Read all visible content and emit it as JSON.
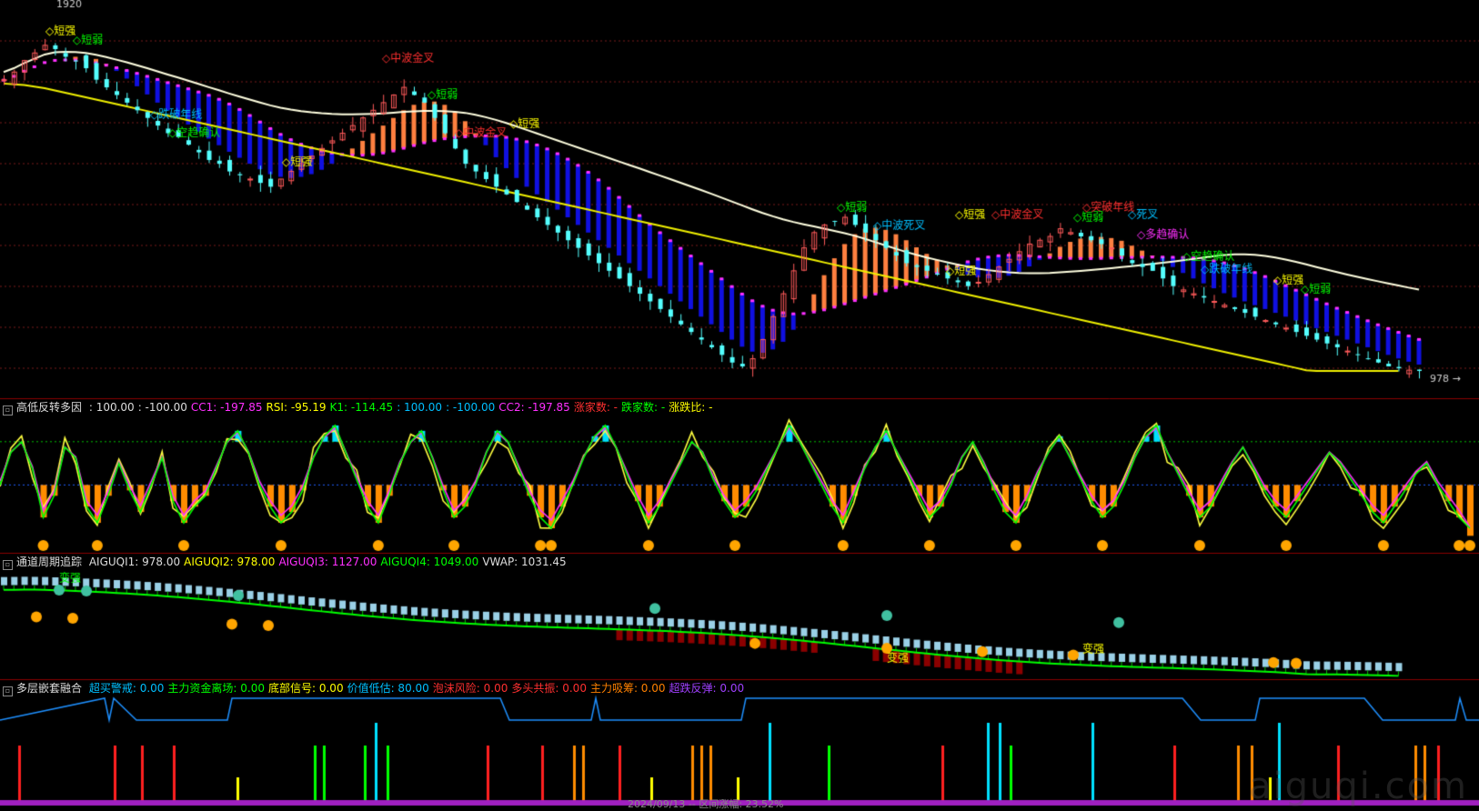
{
  "colors": {
    "background": "#000000",
    "separator": "#8b0000",
    "grid": "#7a1a1a",
    "candle_up": "#ff5a5a",
    "candle_down": "#54ffff",
    "ma_yellow": "#f0f000",
    "ma_white": "#ffffe0",
    "ribbon_blue": "#1010e0",
    "ribbon_orange": "#ff8040",
    "magenta": "#ff30ff"
  },
  "main_panel": {
    "price_high_label": "1920",
    "price_low_label": "978",
    "annotations": [
      {
        "text": "短强",
        "color": "#ffff00"
      },
      {
        "text": "短弱",
        "color": "#00ff00"
      },
      {
        "text": "跌破年线",
        "color": "#00bfff"
      },
      {
        "text": "空趋确认",
        "color": "#00ff00"
      },
      {
        "text": "短强",
        "color": "#ffff00"
      },
      {
        "text": "中波金叉",
        "color": "#ff3030"
      },
      {
        "text": "短弱",
        "color": "#00ff00"
      },
      {
        "text": "中波金叉",
        "color": "#ff3030"
      },
      {
        "text": "短强",
        "color": "#ffff00"
      },
      {
        "text": "短弱",
        "color": "#00ff00"
      },
      {
        "text": "中波死叉",
        "color": "#00bfff"
      },
      {
        "text": "短强",
        "color": "#ffff00"
      },
      {
        "text": "中波金叉",
        "color": "#ff3030"
      },
      {
        "text": "短强",
        "color": "#ffff00"
      },
      {
        "text": "突破年线",
        "color": "#ff3030"
      },
      {
        "text": "短弱",
        "color": "#00ff00"
      },
      {
        "text": "死叉",
        "color": "#00bfff"
      },
      {
        "text": "多趋确认",
        "color": "#ff30ff"
      },
      {
        "text": "空趋确认",
        "color": "#00ff00"
      },
      {
        "text": "跌破年线",
        "color": "#00bfff"
      },
      {
        "text": "短强",
        "color": "#ffff00"
      },
      {
        "text": "短弱",
        "color": "#00ff00"
      }
    ]
  },
  "panel2": {
    "name": "高低反转多因",
    "items": [
      {
        "text": ": 100.00",
        "color": "#dddddd"
      },
      {
        "text": ": -100.00",
        "color": "#dddddd"
      },
      {
        "text": "CC1: -197.85",
        "color": "#ff30ff"
      },
      {
        "text": "RSI: -95.19",
        "color": "#ffff00"
      },
      {
        "text": "K1: -114.45",
        "color": "#00ff00"
      },
      {
        "text": ": 100.00",
        "color": "#00bfff"
      },
      {
        "text": ": -100.00",
        "color": "#00bfff"
      },
      {
        "text": "CC2: -197.85",
        "color": "#ff30ff"
      },
      {
        "text": "涨家数: -",
        "color": "#ff3030"
      },
      {
        "text": "跌家数: -",
        "color": "#00ff00"
      },
      {
        "text": "涨跌比: -",
        "color": "#ffff00"
      }
    ]
  },
  "panel3": {
    "name": "通道周期追踪",
    "items": [
      {
        "text": "AIGUQI1: 978.00",
        "color": "#dddddd"
      },
      {
        "text": "AIGUQI2: 978.00",
        "color": "#ffff00"
      },
      {
        "text": "AIGUQI3: 1127.00",
        "color": "#ff30ff"
      },
      {
        "text": "AIGUQI4: 1049.00",
        "color": "#00ff00"
      },
      {
        "text": "VWAP: 1031.45",
        "color": "#dddddd"
      }
    ],
    "annotations": [
      {
        "text": "变强",
        "color": "#00ff00"
      },
      {
        "text": "变强",
        "color": "#ffff00"
      },
      {
        "text": "变强",
        "color": "#ffff00"
      }
    ]
  },
  "panel4": {
    "name": "多层嵌套融合",
    "items": [
      {
        "text": "超买警戒: 0.00",
        "color": "#00bfff"
      },
      {
        "text": "主力资金离场: 0.00",
        "color": "#00ff00"
      },
      {
        "text": "底部信号: 0.00",
        "color": "#ffff00"
      },
      {
        "text": "价值低估: 80.00",
        "color": "#00bfff"
      },
      {
        "text": "泡沫风险: 0.00",
        "color": "#ff3030"
      },
      {
        "text": "多头共振: 0.00",
        "color": "#ff3030"
      },
      {
        "text": "主力吸筹: 0.00",
        "color": "#ff8000"
      },
      {
        "text": "超跌反弹: 0.00",
        "color": "#a040ff"
      }
    ]
  },
  "footer_text": "2024/09/13 -- 区间涨幅: 23.52%",
  "watermark": "aiguqi.com",
  "chart_data": {
    "type": "candlestick",
    "title": "",
    "ylim": [
      978,
      1920
    ],
    "close": [
      1740,
      1760,
      1790,
      1810,
      1830,
      1820,
      1800,
      1790,
      1770,
      1740,
      1720,
      1700,
      1680,
      1660,
      1640,
      1620,
      1600,
      1590,
      1570,
      1550,
      1530,
      1520,
      1500,
      1490,
      1480,
      1470,
      1460,
      1480,
      1500,
      1520,
      1540,
      1560,
      1580,
      1600,
      1620,
      1640,
      1660,
      1680,
      1700,
      1720,
      1700,
      1680,
      1640,
      1600,
      1560,
      1520,
      1500,
      1480,
      1460,
      1440,
      1420,
      1400,
      1380,
      1360,
      1340,
      1320,
      1300,
      1280,
      1260,
      1240,
      1220,
      1200,
      1180,
      1160,
      1140,
      1120,
      1100,
      1080,
      1060,
      1040,
      1020,
      1000,
      990,
      1010,
      1060,
      1120,
      1180,
      1240,
      1300,
      1340,
      1360,
      1370,
      1380,
      1360,
      1340,
      1320,
      1300,
      1280,
      1260,
      1250,
      1240,
      1230,
      1220,
      1210,
      1200,
      1210,
      1230,
      1250,
      1270,
      1290,
      1310,
      1320,
      1330,
      1350,
      1340,
      1330,
      1320,
      1310,
      1300,
      1280,
      1260,
      1250,
      1240,
      1220,
      1200,
      1190,
      1180,
      1170,
      1160,
      1150,
      1140,
      1130,
      1120,
      1110,
      1100,
      1090,
      1080,
      1070,
      1060,
      1050,
      1040,
      1030,
      1020,
      1010,
      1000,
      990,
      985,
      980,
      978
    ],
    "ma_yellow": [
      1730,
      1728,
      1726,
      1722,
      1718,
      1712,
      1706,
      1700,
      1694,
      1688,
      1682,
      1676,
      1670,
      1664,
      1658,
      1652,
      1646,
      1640,
      1634,
      1628,
      1622,
      1616,
      1610,
      1604,
      1598,
      1592,
      1586,
      1580,
      1574,
      1568,
      1562,
      1556,
      1550,
      1544,
      1538,
      1532,
      1526,
      1520,
      1514,
      1508,
      1502,
      1496,
      1490,
      1484,
      1478,
      1472,
      1466,
      1460,
      1454,
      1448,
      1442,
      1436,
      1430,
      1424,
      1418,
      1412,
      1406,
      1400,
      1394,
      1388,
      1382,
      1376,
      1370,
      1364,
      1358,
      1352,
      1346,
      1340,
      1334,
      1328,
      1322,
      1316,
      1310,
      1304,
      1298,
      1292,
      1286,
      1280,
      1274,
      1268,
      1262,
      1256,
      1250,
      1244,
      1238,
      1232,
      1226,
      1220,
      1214,
      1208,
      1202,
      1196,
      1190,
      1184,
      1178,
      1172,
      1166,
      1160,
      1154,
      1148,
      1142,
      1136,
      1130,
      1124,
      1118,
      1112,
      1106,
      1100,
      1094,
      1088,
      1082,
      1076,
      1070,
      1064,
      1058,
      1052,
      1046,
      1040,
      1034,
      1028,
      1022,
      1016,
      1010,
      1004,
      998,
      992,
      986,
      980,
      978,
      978,
      978,
      978,
      978,
      978,
      978,
      978,
      978
    ],
    "indicator_k1": [
      -20,
      40,
      60,
      10,
      -80,
      -40,
      50,
      30,
      -60,
      -90,
      -40,
      20,
      -30,
      -70,
      -20,
      30,
      -50,
      -90,
      -60,
      -40,
      10,
      60,
      80,
      40,
      -20,
      -60,
      -90,
      -70,
      -30,
      30,
      70,
      90,
      40,
      -10,
      -60,
      -90,
      -40,
      20,
      60,
      80,
      30,
      -30,
      -80,
      -60,
      -20,
      40,
      80,
      60,
      10,
      -40,
      -80,
      -100,
      -60,
      -20,
      30,
      70,
      90,
      50,
      0,
      -50,
      -90,
      -60,
      -20,
      20,
      60,
      40,
      -10,
      -50,
      -80,
      -60,
      -30,
      10,
      50,
      90,
      60,
      20,
      -20,
      -60,
      -90,
      -40,
      10,
      50,
      80,
      40,
      0,
      -40,
      -80,
      -60,
      -20,
      30,
      60,
      20,
      -30,
      -70,
      -90,
      -50,
      0,
      40,
      70,
      30,
      -10,
      -50,
      -80,
      -60,
      -20,
      30,
      70,
      90,
      40,
      0,
      -40,
      -80,
      -60,
      -20,
      20,
      50,
      10,
      -30,
      -60,
      -80,
      -50,
      -20,
      10,
      40,
      20,
      -10,
      -40,
      -70,
      -90,
      -60,
      -30,
      0,
      20,
      -20,
      -50,
      -80,
      -114
    ]
  }
}
